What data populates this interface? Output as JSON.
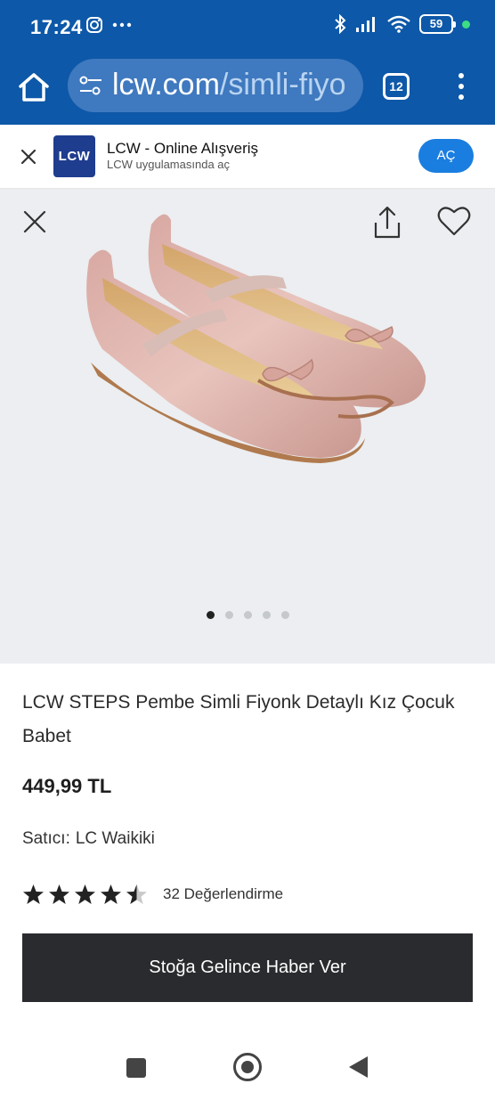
{
  "status_bar": {
    "time": "17:24",
    "battery": "59",
    "icons": [
      "instagram-icon",
      "more-icon",
      "bluetooth-icon",
      "signal-icon",
      "wifi-icon",
      "battery-icon"
    ]
  },
  "browser": {
    "url_host": "lcw.com",
    "url_path": "/simli-fiyo",
    "tab_count": "12"
  },
  "app_banner": {
    "logo_text": "LCW",
    "app_name": "LCW - Online Alışveriş",
    "subtitle": "LCW uygulamasında aç",
    "open_label": "AÇ"
  },
  "gallery": {
    "image_count": 5,
    "active_index": 0
  },
  "product": {
    "title": "LCW STEPS Pembe Simli Fiyonk Detaylı Kız Çocuk Babet",
    "price": "449,99 TL",
    "seller_label": "Satıcı:",
    "seller_name": "LC Waikiki",
    "rating": 4.5,
    "review_count_label": "32 Değerlendirme",
    "notify_button": "Stoğa Gelince Haber Ver"
  },
  "colors": {
    "browser_blue": "#0d58a8",
    "open_button": "#1a7ee0",
    "cta_dark": "#2a2b2e",
    "star": "#222222"
  }
}
